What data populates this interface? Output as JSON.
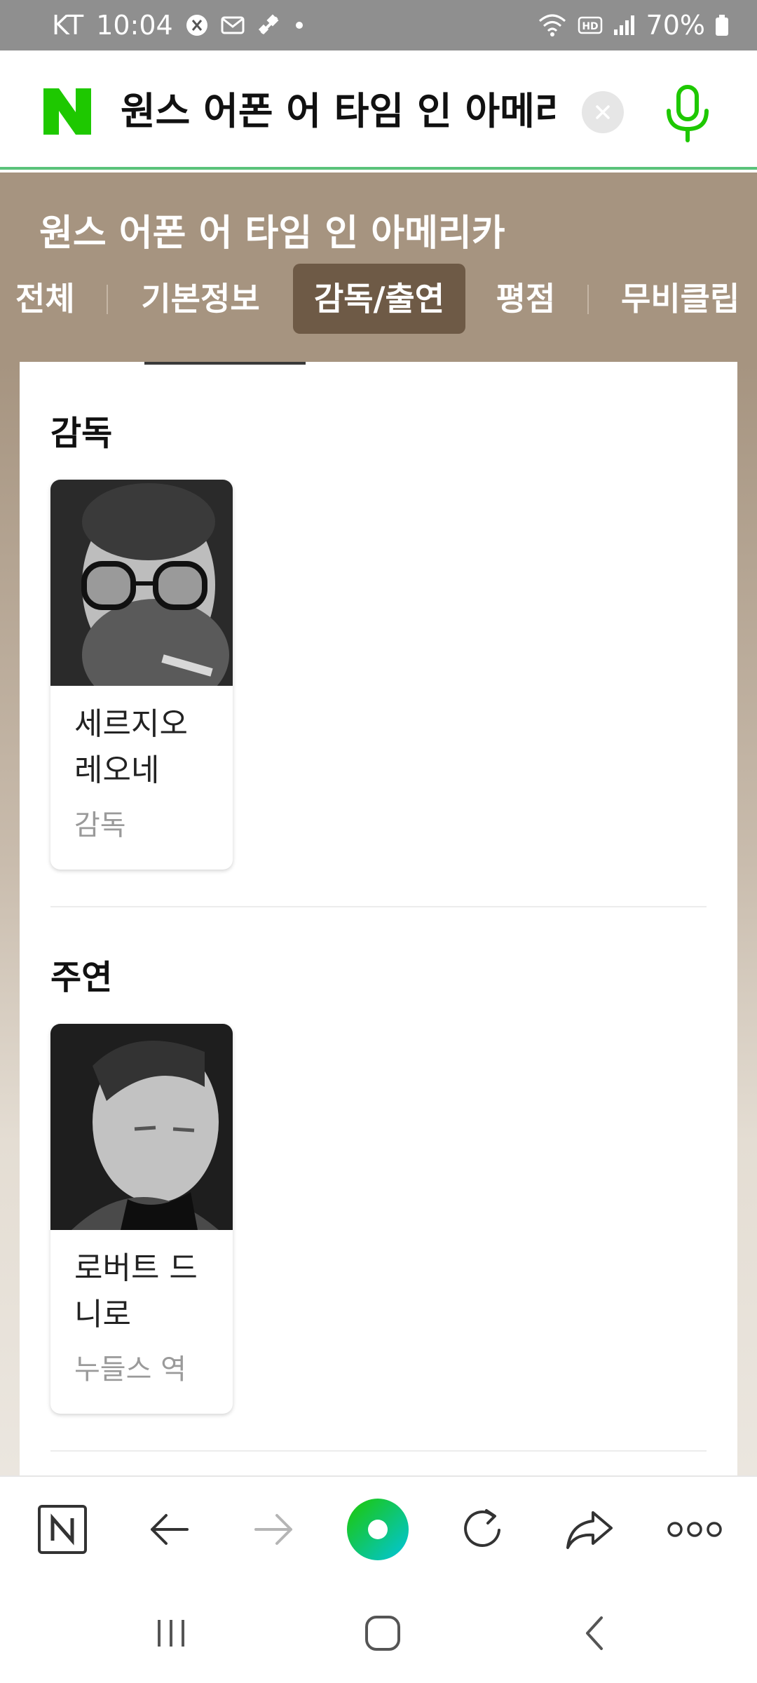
{
  "status_bar": {
    "carrier": "KT",
    "time": "10:04",
    "battery": "70%",
    "icons": [
      "x-app-icon",
      "mail-icon",
      "satellite-icon",
      "dot-icon",
      "wifi-icon",
      "hd-icon",
      "signal-icon",
      "battery-icon"
    ]
  },
  "search": {
    "logo": "N",
    "query": "원스 어폰 어 타임 인 아메리카",
    "logo_color": "#1ec800",
    "mic_color": "#1ec800"
  },
  "movie": {
    "title": "원스 어폰 어 타임 인 아메리카",
    "panel_color": "#a69480",
    "active_tab_color": "#6e5a46"
  },
  "tabs": [
    "전체",
    "기본정보",
    "감독/출연",
    "평점",
    "무비클립"
  ],
  "active_tab_index": 2,
  "sections": [
    {
      "title": "감독",
      "people": [
        {
          "name": "세르지오 레오네",
          "role": "감독"
        }
      ]
    },
    {
      "title": "주연",
      "people": [
        {
          "name": "로버트 드니로",
          "role": "누들스 역"
        }
      ]
    }
  ],
  "toolbar": {
    "buttons": [
      "naver-home-icon",
      "back-arrow-icon",
      "forward-arrow-icon",
      "green-dot-icon",
      "refresh-icon",
      "share-icon",
      "more-icon"
    ]
  },
  "system_nav": {
    "buttons": [
      "recent-apps-icon",
      "home-icon",
      "back-icon"
    ]
  }
}
